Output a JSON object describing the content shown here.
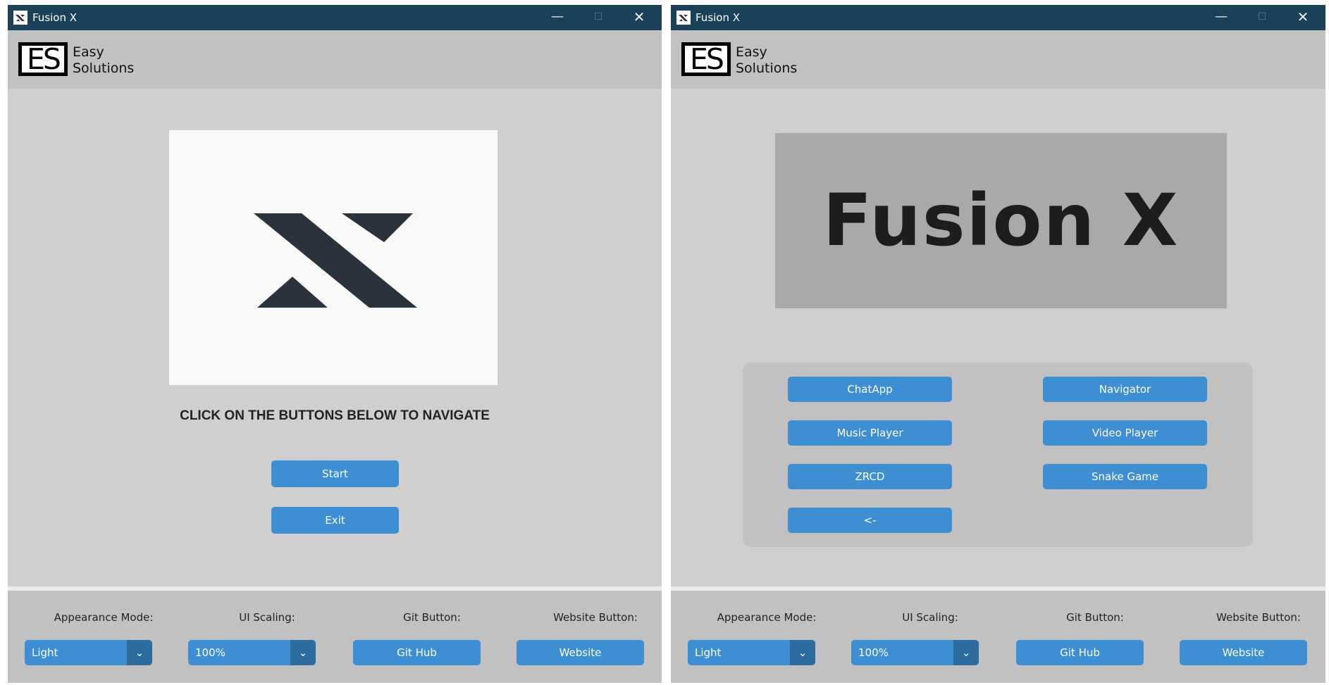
{
  "windows": [
    {
      "title": "Fusion X",
      "header": {
        "logo_letters": "ES",
        "brand_line1": "Easy",
        "brand_line2": "Solutions"
      },
      "main": {
        "instruction": "CLICK ON THE BUTTONS BELOW TO NAVIGATE",
        "start_label": "Start",
        "exit_label": "Exit"
      },
      "footer": {
        "appearance_label": "Appearance Mode:",
        "appearance_value": "Light",
        "scaling_label": "UI Scaling:",
        "scaling_value": "100%",
        "git_label": "Git Button:",
        "git_button": "Git Hub",
        "website_label": "Website Button:",
        "website_button": "Website"
      }
    },
    {
      "title": "Fusion X",
      "header": {
        "logo_letters": "ES",
        "brand_line1": "Easy",
        "brand_line2": "Solutions"
      },
      "main": {
        "banner_text": "Fusion X",
        "nav_buttons": [
          "ChatApp",
          "Navigator",
          "Music Player",
          "Video Player",
          "ZRCD",
          "Snake Game",
          "<-"
        ]
      },
      "footer": {
        "appearance_label": "Appearance Mode:",
        "appearance_value": "Light",
        "scaling_label": "UI Scaling:",
        "scaling_value": "100%",
        "git_label": "Git Button:",
        "git_button": "Git Hub",
        "website_label": "Website Button:",
        "website_button": "Website"
      }
    }
  ],
  "icons": {
    "app": "fusion-x-logo-icon",
    "minimize": "minimize-icon",
    "maximize": "maximize-icon",
    "close": "close-icon",
    "dropdown": "chevron-down-icon"
  },
  "colors": {
    "titlebar": "#1b4159",
    "button": "#3d8ed3",
    "dropdown_arrow_bg": "#2d6c9e",
    "window_bg": "#cfcfcf",
    "header_bg": "#c1c1c1",
    "logo_mark": "#2a333d"
  }
}
